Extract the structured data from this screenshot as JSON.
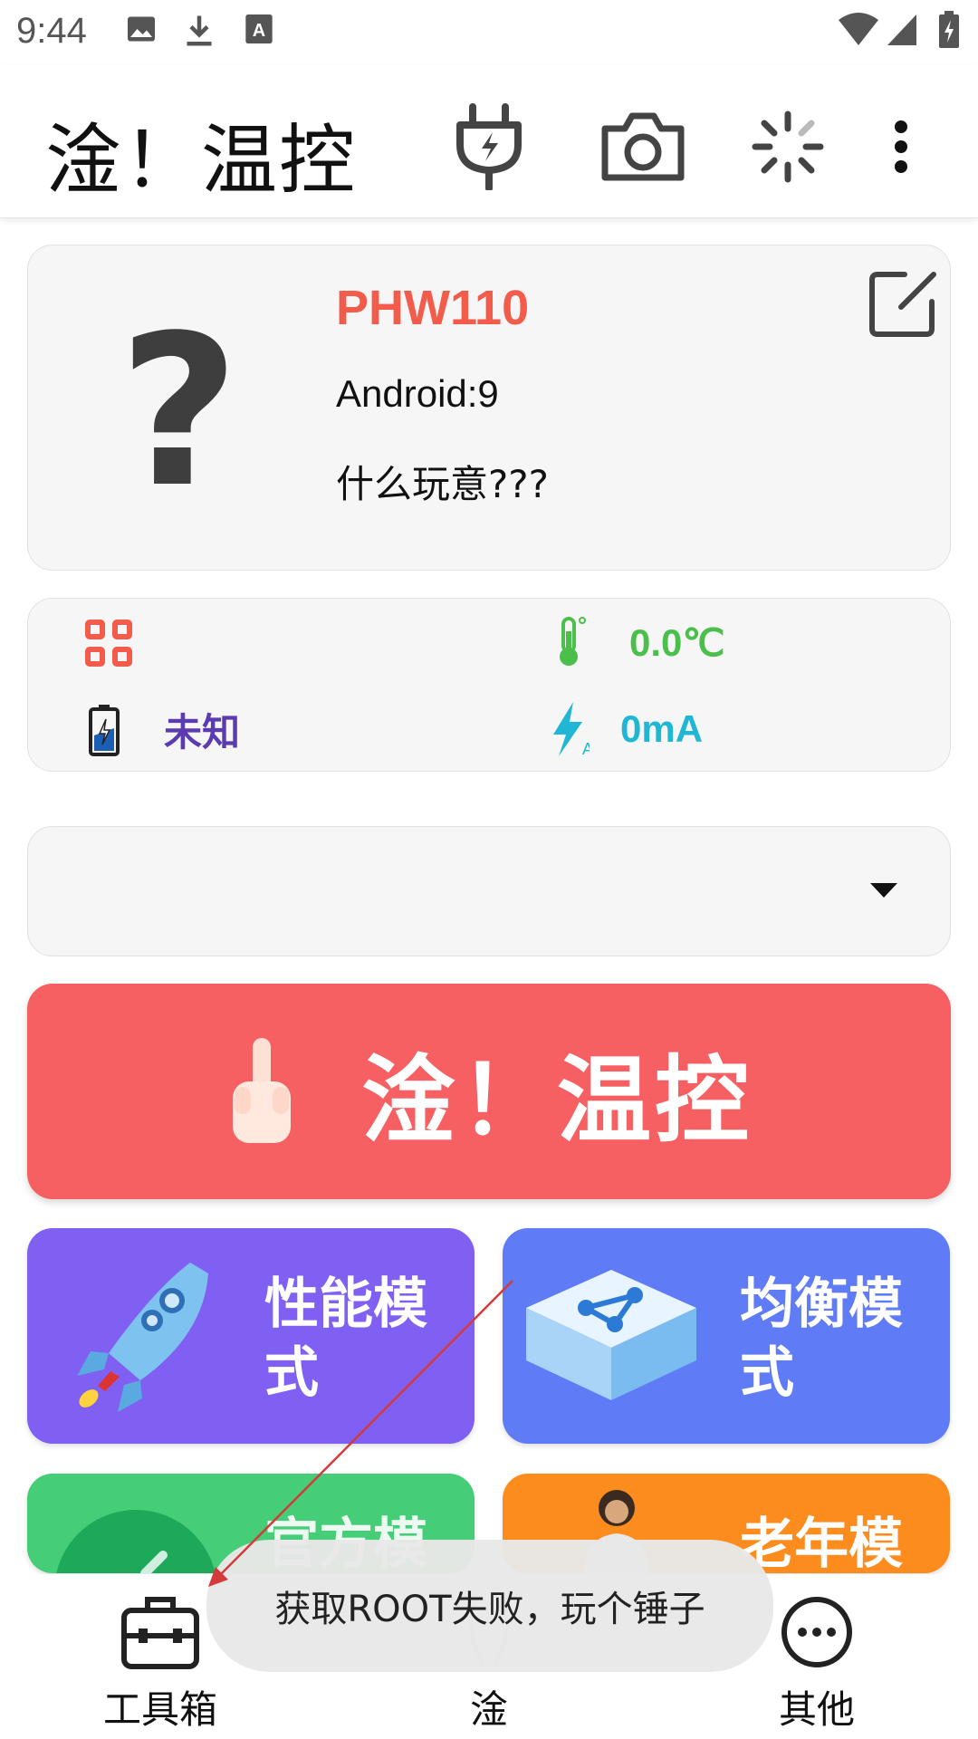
{
  "status_bar": {
    "time": "9:44"
  },
  "app_bar": {
    "title": "淦！温控"
  },
  "device": {
    "model": "PHW110",
    "android": "Android:9",
    "description": "什么玩意???"
  },
  "stats": {
    "battery_status": "未知",
    "temperature": "0.0℃",
    "current": "0mA",
    "colors": {
      "temp": "#4bbf4b",
      "current": "#1fb7d4",
      "battery": "#5c3bb0",
      "grid": "#f35b4b"
    }
  },
  "mode_select": {
    "value": ""
  },
  "main_button": {
    "label": "淦！温控"
  },
  "modes": {
    "performance": "性能模式",
    "balanced": "均衡模式",
    "official": "官方模",
    "elderly": "老年模"
  },
  "bottom_nav": {
    "toolbox": "工具箱",
    "center": "淦",
    "others": "其他"
  },
  "toast": {
    "message": "获取ROOT失败，玩个锤子"
  }
}
